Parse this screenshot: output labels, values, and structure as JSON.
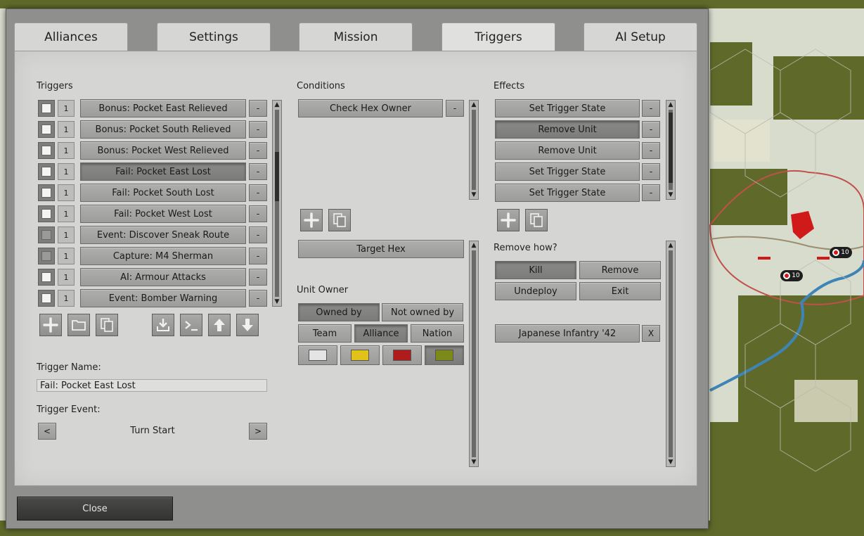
{
  "tabs": [
    "Alliances",
    "Settings",
    "Mission",
    "Triggers",
    "AI Setup"
  ],
  "triggers": {
    "label": "Triggers",
    "items": [
      {
        "count": "1",
        "name": "Bonus: Pocket East Relieved",
        "enabled": true
      },
      {
        "count": "1",
        "name": "Bonus: Pocket South Relieved",
        "enabled": true
      },
      {
        "count": "1",
        "name": "Bonus: Pocket West Relieved",
        "enabled": true
      },
      {
        "count": "1",
        "name": "Fail: Pocket East Lost",
        "enabled": true
      },
      {
        "count": "1",
        "name": "Fail: Pocket South Lost",
        "enabled": true
      },
      {
        "count": "1",
        "name": "Fail: Pocket West Lost",
        "enabled": true
      },
      {
        "count": "1",
        "name": "Event: Discover Sneak Route",
        "enabled": false
      },
      {
        "count": "1",
        "name": "Capture: M4 Sherman",
        "enabled": false
      },
      {
        "count": "1",
        "name": "AI: Armour Attacks",
        "enabled": true
      },
      {
        "count": "1",
        "name": "Event: Bomber Warning",
        "enabled": true
      }
    ],
    "remove_label": "-",
    "name_label": "Trigger Name:",
    "name_value": "Fail: Pocket East Lost",
    "event_label": "Trigger Event:",
    "event_value": "Turn Start",
    "prev": "<",
    "next": ">"
  },
  "conditions": {
    "label": "Conditions",
    "items": [
      "Check Hex Owner"
    ],
    "target_hex": "Target Hex",
    "unit_owner_label": "Unit Owner",
    "owned_by": "Owned by",
    "not_owned_by": "Not owned by",
    "team": "Team",
    "alliance": "Alliance",
    "nation": "Nation",
    "swatch_colors": [
      "#e4e4e4",
      "#e0c21a",
      "#b01c1c",
      "#7c8a1a"
    ]
  },
  "effects": {
    "label": "Effects",
    "items": [
      "Set Trigger State",
      "Remove Unit",
      "Remove Unit",
      "Set Trigger State",
      "Set Trigger State"
    ],
    "remove_how_label": "Remove how?",
    "kill": "Kill",
    "remove": "Remove",
    "undeploy": "Undeploy",
    "exit": "Exit",
    "unit": "Japanese Infantry '42",
    "unit_clear": "X"
  },
  "close": "Close",
  "map": {
    "unit_strength": "10"
  }
}
